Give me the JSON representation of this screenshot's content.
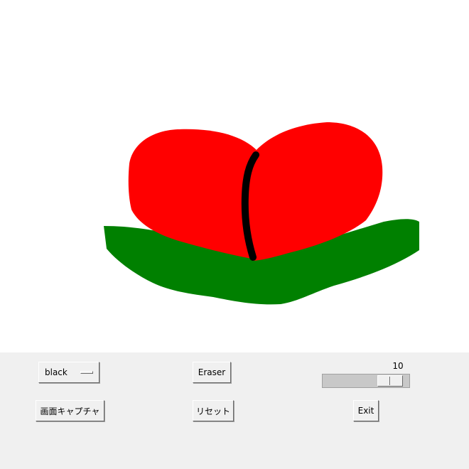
{
  "canvas": {
    "strokes": [
      {
        "name": "red-heart-left-stroke",
        "color": "#ff0000"
      },
      {
        "name": "red-heart-right-stroke",
        "color": "#ff0000"
      },
      {
        "name": "green-leaf-stroke",
        "color": "#008000"
      },
      {
        "name": "black-stem-stroke",
        "color": "#000000"
      }
    ]
  },
  "controls": {
    "color_menu": {
      "value": "black"
    },
    "eraser_label": "Eraser",
    "capture_label": "画面キャプチャ",
    "reset_label": "リセット",
    "exit_label": "Exit",
    "pen_size": {
      "value": 10,
      "min": 1,
      "max": 11
    }
  },
  "colors": {
    "panel_bg": "#f0f0f0",
    "canvas_bg": "#ffffff",
    "red": "#ff0000",
    "green": "#008000",
    "black": "#000000"
  }
}
